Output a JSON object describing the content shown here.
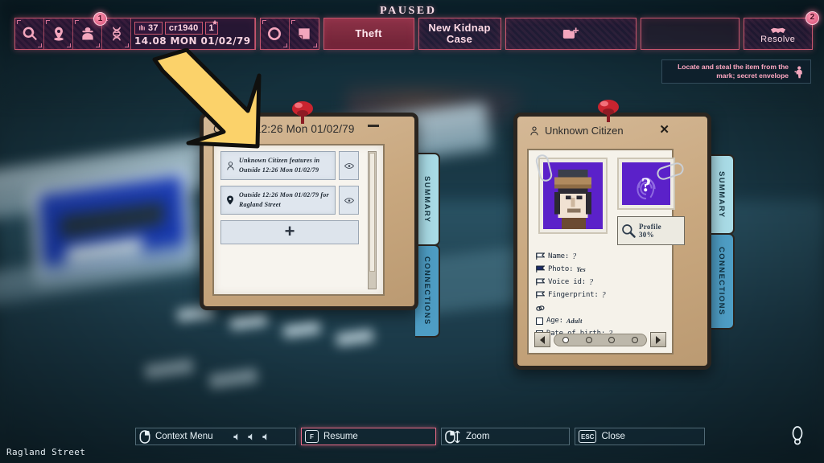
{
  "status": {
    "paused_label": "PAUSED",
    "street_label": "Ragland Street"
  },
  "topbar": {
    "icons": [
      {
        "name": "search-icon",
        "label": "Search"
      },
      {
        "name": "map-pin-icon",
        "label": "Locations"
      },
      {
        "name": "detective-icon",
        "label": "Suspects",
        "badge": "1"
      },
      {
        "name": "dna-icon",
        "label": "Evidence"
      }
    ],
    "stats": {
      "social_credit": "37",
      "money": "cr1940",
      "level": "1"
    },
    "clock": "14.08 MON 01/02/79",
    "mode_icons": [
      {
        "name": "circle-icon",
        "label": "Case ring"
      },
      {
        "name": "case-notes-icon",
        "label": "Case notes"
      }
    ],
    "buttons": [
      {
        "name": "case-theft-button",
        "label": "Theft"
      },
      {
        "name": "new-kidnap-case-button",
        "label": "New Kidnap Case"
      },
      {
        "name": "new-case-folder-button",
        "label": ""
      },
      {
        "name": "empty-slot",
        "label": ""
      },
      {
        "name": "resolve-button",
        "label": "Resolve",
        "badge": "2"
      }
    ]
  },
  "tooltip": {
    "text": "Locate and steal the item from the mark; secret envelope",
    "icon": "thief-icon"
  },
  "notes_window": {
    "title": "Outside 12:26 Mon 01/02/79",
    "minimize_label": "–",
    "tabs": [
      {
        "label": "SUMMARY",
        "active": true
      },
      {
        "label": "CONNECTIONS",
        "active": false
      }
    ],
    "entries": [
      {
        "icon": "person-icon",
        "text": "Unknown Citizen features in Outside 12:26 Mon 01/02/79",
        "action": "eye-icon"
      },
      {
        "icon": "map-pin-icon",
        "text": "Outside 12:26 Mon 01/02/79 for Ragland Street",
        "action": "eye-icon"
      }
    ],
    "add_label": "+"
  },
  "citizen_window": {
    "title": "Unknown Citizen",
    "close_label": "✕",
    "tabs": [
      {
        "label": "SUMMARY",
        "active": true
      },
      {
        "label": "CONNECTIONS",
        "active": false
      }
    ],
    "fingerprint_placeholder": "?",
    "profile": {
      "label": "Profile",
      "percent": "30%"
    },
    "attributes": [
      {
        "label": "Name:",
        "value": "?",
        "marker": "flag-outline",
        "unknown": true
      },
      {
        "label": "Photo:",
        "value": "Yes",
        "marker": "flag-filled",
        "unknown": false
      },
      {
        "label": "Voice id:",
        "value": "?",
        "marker": "flag-outline",
        "unknown": true
      },
      {
        "label": "Fingerprint:",
        "value": "?",
        "marker": "flag-outline",
        "unknown": true
      },
      {
        "label": "",
        "value": "",
        "marker": "link-icon",
        "unknown": false
      },
      {
        "label": "Age:",
        "value": "Adult",
        "marker": "checkbox",
        "unknown": false
      },
      {
        "label": "Date of birth:",
        "value": "?",
        "marker": "checkbox",
        "unknown": true
      }
    ],
    "pager": {
      "pages": 4,
      "active": 1,
      "prev": "◀",
      "next": "▶"
    }
  },
  "bottombar": [
    {
      "name": "context-menu-control",
      "key_icon": "mouse-right-icon",
      "key": "",
      "label": "Context Menu",
      "accent": false
    },
    {
      "name": "resume-control",
      "key_icon": "",
      "key": "F",
      "label": "Resume",
      "accent": true
    },
    {
      "name": "zoom-control",
      "key_icon": "mouse-scroll-icon",
      "key": "",
      "label": "Zoom",
      "accent": false
    },
    {
      "name": "close-control",
      "key_icon": "",
      "key": "ESC",
      "label": "Close",
      "accent": false
    }
  ],
  "colors": {
    "accent_pink": "#e76a86",
    "tab_active": "#a9dbe6",
    "tab_inactive": "#4e9dc4",
    "paper": "#f5f2ea",
    "portrait_bg": "#5b21c9"
  }
}
